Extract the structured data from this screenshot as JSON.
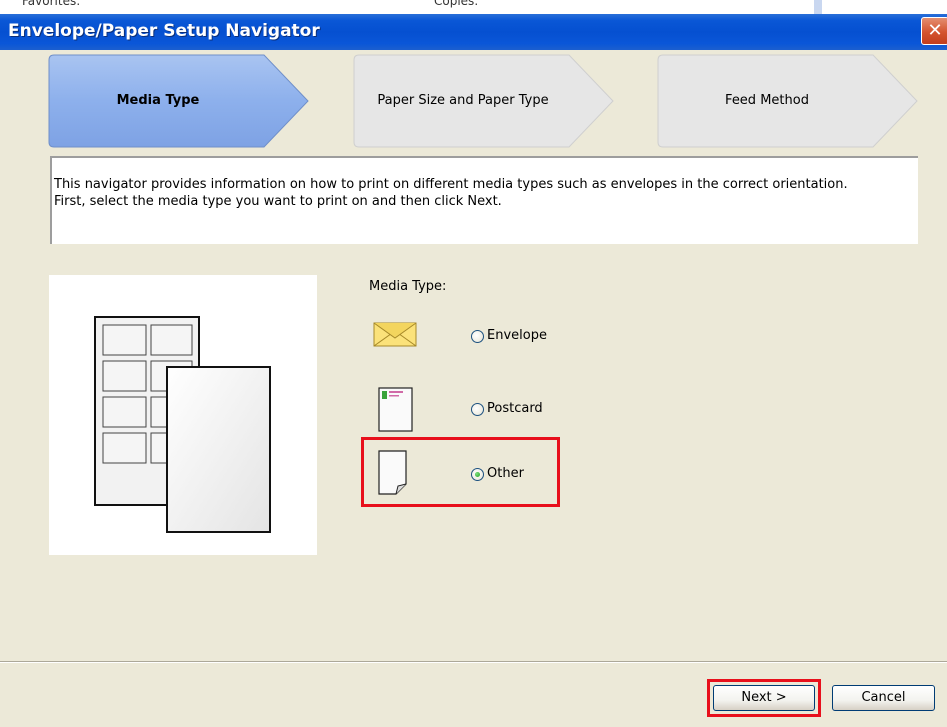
{
  "background_window": {
    "left_label": "Favorites:",
    "right_label": "Copies:"
  },
  "dialog": {
    "title": "Envelope/Paper Setup Navigator",
    "close_icon": "close-icon"
  },
  "steps": [
    {
      "label": "Media Type",
      "active": true
    },
    {
      "label": "Paper Size and Paper Type",
      "active": false
    },
    {
      "label": "Feed Method",
      "active": false
    }
  ],
  "description": {
    "line1": "This navigator provides information on how to print on different media types such as envelopes in the correct orientation.",
    "line2": "First, select the media type you want to print on and then click Next."
  },
  "media": {
    "label": "Media Type:",
    "options": [
      {
        "label": "Envelope",
        "icon": "envelope-icon",
        "selected": false
      },
      {
        "label": "Postcard",
        "icon": "postcard-icon",
        "selected": false
      },
      {
        "label": "Other",
        "icon": "other-paper-icon",
        "selected": true
      }
    ]
  },
  "buttons": {
    "next": "Next >",
    "cancel": "Cancel"
  },
  "colors": {
    "title_bar": "#0550d1",
    "active_step": "#8fb0ea",
    "inactive_step": "#e6e6e6",
    "highlight": "#e8101c"
  }
}
